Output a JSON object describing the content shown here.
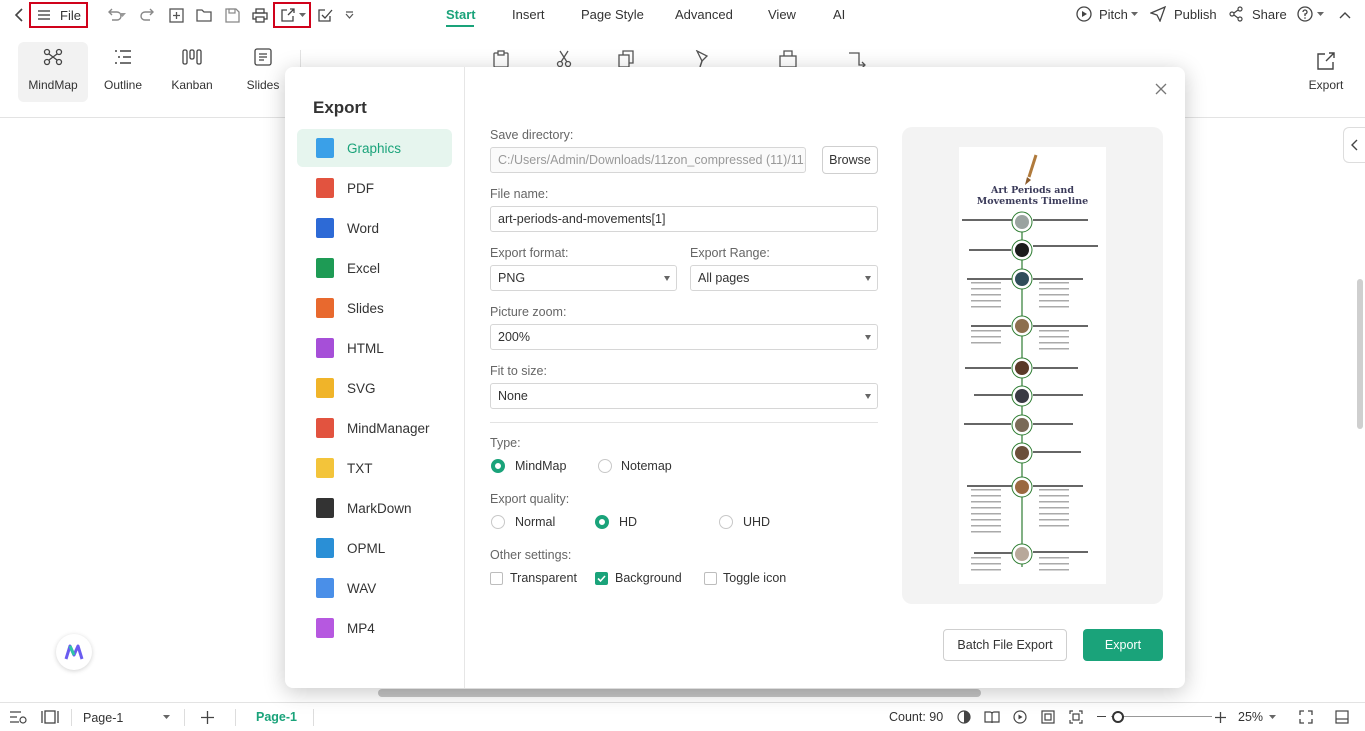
{
  "toolbar": {
    "file_label": "File"
  },
  "menu": {
    "tabs": [
      "Start",
      "Insert",
      "Page Style",
      "Advanced",
      "View",
      "AI"
    ],
    "active": "Start"
  },
  "top_right": {
    "pitch": "Pitch",
    "publish": "Publish",
    "share": "Share"
  },
  "views": {
    "mindmap": "MindMap",
    "outline": "Outline",
    "kanban": "Kanban",
    "slides": "Slides"
  },
  "ribbon_right": {
    "export": "Export"
  },
  "dialog": {
    "title": "Export",
    "formats": [
      {
        "label": "Graphics",
        "icon": "image-icon",
        "color": "#3aa0e8"
      },
      {
        "label": "PDF",
        "icon": "pdf-icon",
        "color": "#e2533f"
      },
      {
        "label": "Word",
        "icon": "word-icon",
        "color": "#2d6ad6"
      },
      {
        "label": "Excel",
        "icon": "excel-icon",
        "color": "#1e9b55"
      },
      {
        "label": "Slides",
        "icon": "slides-icon",
        "color": "#e8692e"
      },
      {
        "label": "HTML",
        "icon": "html-icon",
        "color": "#a64fd8"
      },
      {
        "label": "SVG",
        "icon": "svg-icon",
        "color": "#f0b429"
      },
      {
        "label": "MindManager",
        "icon": "mindmanager-icon",
        "color": "#e2533f"
      },
      {
        "label": "TXT",
        "icon": "txt-icon",
        "color": "#f3c43a"
      },
      {
        "label": "MarkDown",
        "icon": "markdown-icon",
        "color": "#333333"
      },
      {
        "label": "OPML",
        "icon": "opml-icon",
        "color": "#2a8fd6"
      },
      {
        "label": "WAV",
        "icon": "wav-icon",
        "color": "#4a8fe8"
      },
      {
        "label": "MP4",
        "icon": "mp4-icon",
        "color": "#b658e0"
      }
    ],
    "active_format": "Graphics",
    "save_directory": {
      "label": "Save directory:",
      "value": "C:/Users/Admin/Downloads/11zon_compressed (11)/11...",
      "browse": "Browse"
    },
    "file_name": {
      "label": "File name:",
      "value": "art-periods-and-movements[1]"
    },
    "export_format": {
      "label": "Export format:",
      "value": "PNG"
    },
    "export_range": {
      "label": "Export Range:",
      "value": "All pages"
    },
    "picture_zoom": {
      "label": "Picture zoom:",
      "value": "200%"
    },
    "fit_to_size": {
      "label": "Fit to size:",
      "value": "None"
    },
    "type": {
      "label": "Type:",
      "options": [
        "MindMap",
        "Notemap"
      ],
      "selected": "MindMap"
    },
    "quality": {
      "label": "Export quality:",
      "options": [
        "Normal",
        "HD",
        "UHD"
      ],
      "selected": "HD"
    },
    "other": {
      "label": "Other settings:",
      "transparent": "Transparent",
      "background": "Background",
      "toggle_icon": "Toggle icon",
      "transparent_checked": false,
      "background_checked": true,
      "toggle_icon_checked": false
    },
    "preview": {
      "title_line1": "Art Periods and",
      "title_line2": "Movements Timeline"
    },
    "batch_button": "Batch File Export",
    "export_button": "Export"
  },
  "status": {
    "page_select": "Page-1",
    "page_tab": "Page-1",
    "count": "Count: 90",
    "zoom": "25%"
  },
  "colors": {
    "accent": "#1aa37a",
    "highlight_box": "#d0021b"
  }
}
